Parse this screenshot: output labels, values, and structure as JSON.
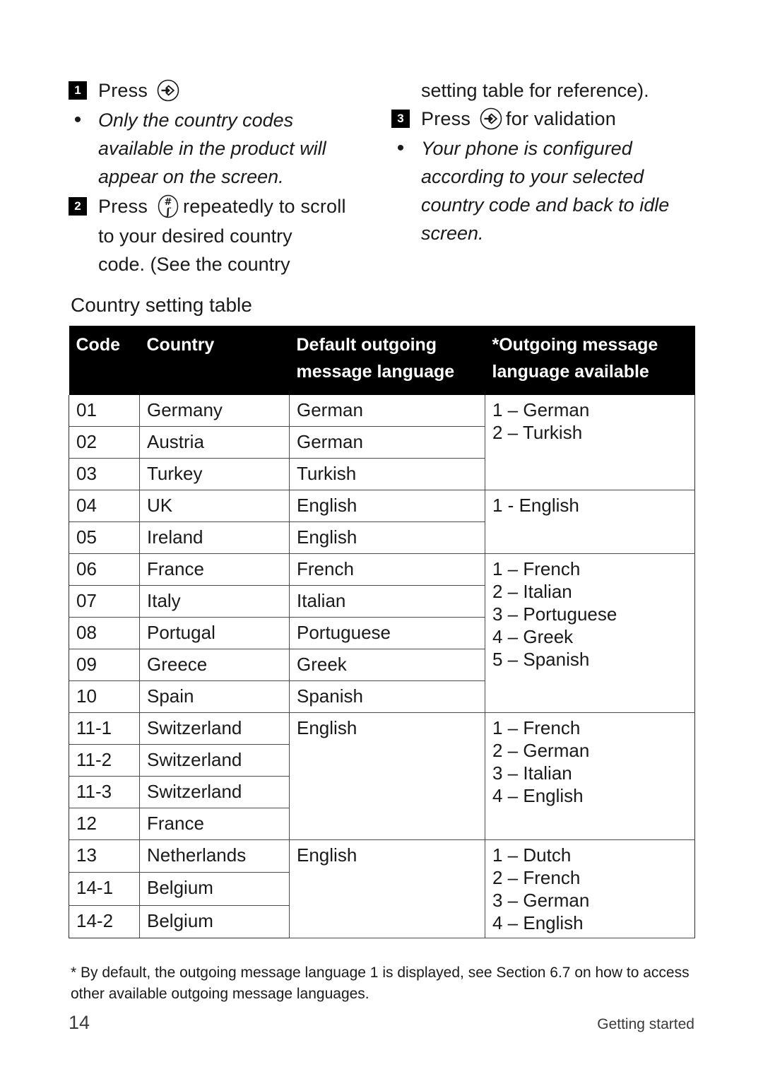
{
  "instructions": {
    "left_column": {
      "step1": {
        "number": "1",
        "text_before": "Press",
        "icon": "menu-key-icon"
      },
      "note1": {
        "bullet": "•",
        "text": "Only the country codes available in the product will appear on the screen."
      },
      "step2": {
        "number": "2",
        "text_before": "Press",
        "icon": "hash-key-icon",
        "text_after": "repeatedly to scroll"
      },
      "step2_cont": [
        "to your desired country",
        "code. (See the country"
      ]
    },
    "right_column": {
      "carryover": "setting table for reference).",
      "step3": {
        "number": "3",
        "text_before": "Press",
        "icon": "menu-key-icon",
        "text_after": "for validation"
      },
      "note3": {
        "bullet": "•",
        "text": "Your phone is configured according to your selected country code and back to idle screen."
      }
    }
  },
  "table_caption": "Country setting table",
  "table": {
    "headers": [
      "Code",
      "Country",
      "Default outgoing message language",
      "*Outgoing message language available"
    ],
    "headers_lines": [
      [
        "Code"
      ],
      [
        "Country"
      ],
      [
        "Default outgoing",
        "message language"
      ],
      [
        "*Outgoing message",
        "language available"
      ]
    ],
    "groups": [
      {
        "rows": [
          {
            "code": "01",
            "country": "Germany",
            "default_language": "German"
          },
          {
            "code": "02",
            "country": "Austria",
            "default_language": "German"
          },
          {
            "code": "03",
            "country": "Turkey",
            "default_language": "Turkish"
          }
        ],
        "available": [
          "1 – German",
          "2 – Turkish"
        ]
      },
      {
        "rows": [
          {
            "code": "04",
            "country": "UK",
            "default_language": "English"
          },
          {
            "code": "05",
            "country": "Ireland",
            "default_language": "English"
          }
        ],
        "available": [
          "1 - English"
        ]
      },
      {
        "rows": [
          {
            "code": "06",
            "country": "France",
            "default_language": "French"
          },
          {
            "code": "07",
            "country": "Italy",
            "default_language": "Italian"
          },
          {
            "code": "08",
            "country": "Portugal",
            "default_language": "Portuguese"
          },
          {
            "code": "09",
            "country": "Greece",
            "default_language": "Greek"
          },
          {
            "code": "10",
            "country": "Spain",
            "default_language": "Spanish"
          }
        ],
        "available": [
          "1 – French",
          "2 – Italian",
          "3 – Portuguese",
          "4 – Greek",
          "5 – Spanish"
        ]
      },
      {
        "rows": [
          {
            "code": "11-1",
            "country": "Switzerland"
          },
          {
            "code": "11-2",
            "country": "Switzerland"
          },
          {
            "code": "11-3",
            "country": "Switzerland"
          },
          {
            "code": "12",
            "country": "France"
          }
        ],
        "default_language_merged": "English",
        "available": [
          "1 – French",
          "2 – German",
          "3 – Italian",
          "4 – English"
        ]
      },
      {
        "rows": [
          {
            "code": "13",
            "country": "Netherlands"
          },
          {
            "code": "14-1",
            "country": "Belgium"
          },
          {
            "code": "14-2",
            "country": "Belgium"
          }
        ],
        "default_language_merged": "English",
        "available": [
          "1 – Dutch",
          "2 – French",
          "3 – German",
          "4 – English"
        ]
      }
    ]
  },
  "footnote": "* By default, the outgoing message language 1 is displayed, see Section 6.7 on how to access other available outgoing message languages.",
  "footer": {
    "page_number": "14",
    "section": "Getting started"
  }
}
